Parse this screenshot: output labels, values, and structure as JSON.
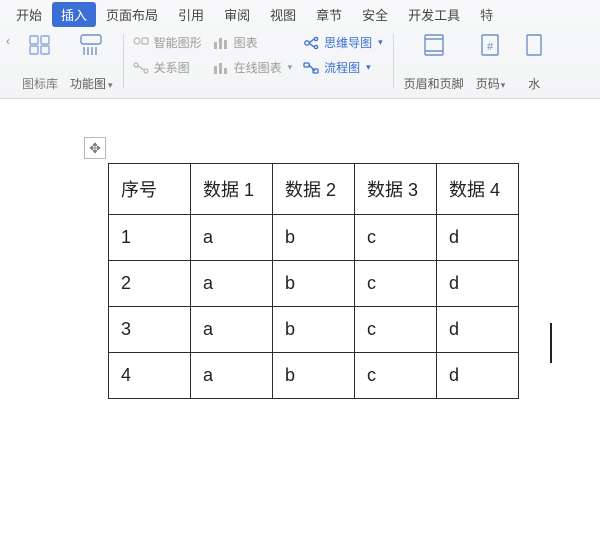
{
  "tabs": {
    "start": "开始",
    "insert": "插入",
    "layout": "页面布局",
    "reference": "引用",
    "review": "审阅",
    "view": "视图",
    "chapter": "章节",
    "security": "安全",
    "devtools": "开发工具",
    "trailing": "特"
  },
  "toolbar": {
    "iconlib": "图标库",
    "funcchart": "功能图",
    "smartart": "智能图形",
    "relchart": "关系图",
    "chart": "图表",
    "onlinechart": "在线图表",
    "mindmap": "思维导图",
    "flowchart": "流程图",
    "headerfooter": "页眉和页脚",
    "pagenumber": "页码",
    "watermark": "水"
  },
  "table": {
    "headers": [
      "序号",
      "数据 1",
      "数据 2",
      "数据 3",
      "数据 4"
    ],
    "rows": [
      [
        "1",
        "a",
        "b",
        "c",
        "d"
      ],
      [
        "2",
        "a",
        "b",
        "c",
        "d"
      ],
      [
        "3",
        "a",
        "b",
        "c",
        "d"
      ],
      [
        "4",
        "a",
        "b",
        "c",
        "d"
      ]
    ]
  },
  "colors": {
    "accent": "#3b6fd6",
    "muted": "#9a9a9a"
  }
}
